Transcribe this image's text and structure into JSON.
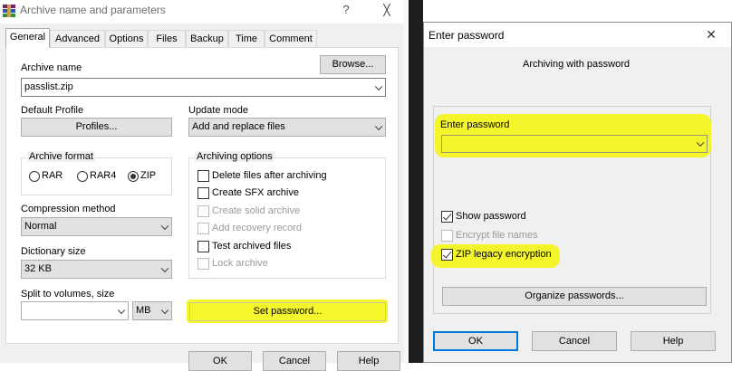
{
  "left_dialog": {
    "title": "Archive name and parameters",
    "help_glyph": "?",
    "close_glyph": "╳",
    "tabs": [
      {
        "label": "General",
        "active": true
      },
      {
        "label": "Advanced"
      },
      {
        "label": "Options"
      },
      {
        "label": "Files"
      },
      {
        "label": "Backup"
      },
      {
        "label": "Time"
      },
      {
        "label": "Comment"
      }
    ],
    "archive_name_label": "Archive name",
    "browse_label": "Browse...",
    "archive_name_value": "passlist.zip",
    "default_profile_label": "Default Profile",
    "profiles_label": "Profiles...",
    "update_mode_label": "Update mode",
    "update_mode_value": "Add and replace files",
    "archive_format_label": "Archive format",
    "formats": [
      "RAR",
      "RAR4",
      "ZIP"
    ],
    "selected_format": "ZIP",
    "compression_method_label": "Compression method",
    "compression_method_value": "Normal",
    "dictionary_size_label": "Dictionary size",
    "dictionary_size_value": "32 KB",
    "split_label": "Split to volumes, size",
    "split_value": "",
    "split_unit": "MB",
    "archiving_options_label": "Archiving options",
    "options": [
      {
        "label": "Delete files after archiving",
        "checked": false,
        "enabled": true
      },
      {
        "label": "Create SFX archive",
        "checked": false,
        "enabled": true
      },
      {
        "label": "Create solid archive",
        "checked": false,
        "enabled": false
      },
      {
        "label": "Add recovery record",
        "checked": false,
        "enabled": false
      },
      {
        "label": "Test archived files",
        "checked": false,
        "enabled": true
      },
      {
        "label": "Lock archive",
        "checked": false,
        "enabled": false
      }
    ],
    "set_password_label": "Set password...",
    "ok_label": "OK",
    "cancel_label": "Cancel",
    "help_label": "Help"
  },
  "right_dialog": {
    "title": "Enter password",
    "close_glyph": "✕",
    "subtitle": "Archiving with password",
    "enter_password_label": "Enter password",
    "password_value": "",
    "show_password_label": "Show password",
    "show_password_checked": true,
    "encrypt_names_label": "Encrypt file names",
    "encrypt_names_checked": false,
    "zip_legacy_label": "ZIP legacy encryption",
    "zip_legacy_checked": true,
    "organize_label": "Organize passwords...",
    "ok_label": "OK",
    "cancel_label": "Cancel",
    "help_label": "Help"
  },
  "colors": {
    "highlight": "#f5f51a",
    "dialog_bg": "#f0f0f0",
    "focus_border": "#0078d7"
  }
}
